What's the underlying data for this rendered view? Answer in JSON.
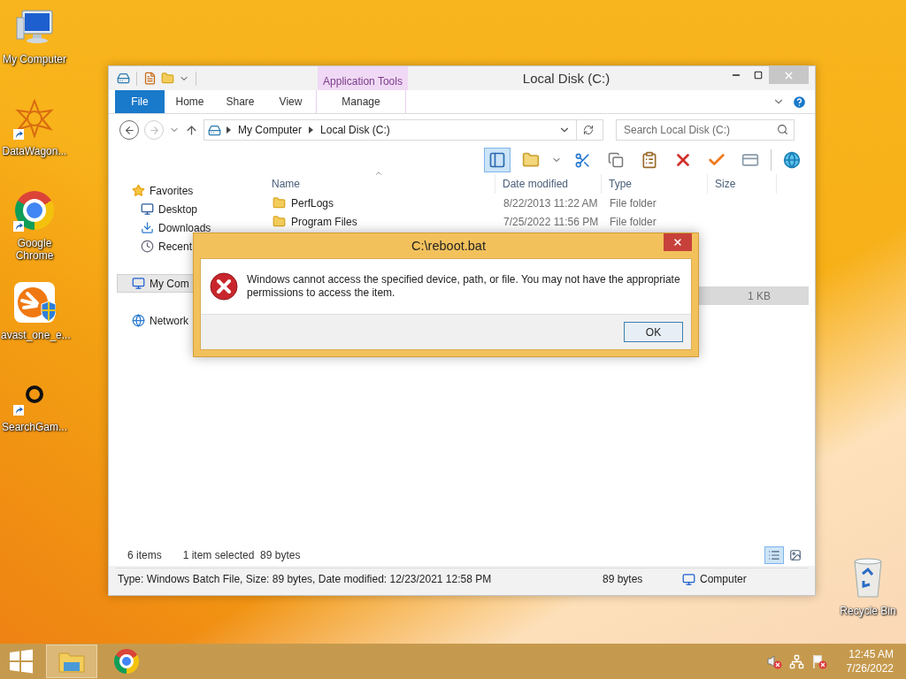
{
  "desktop_icons": [
    {
      "label": "My Computer",
      "kind": "computer",
      "shortcut": false
    },
    {
      "label": "DataWagon...",
      "kind": "datawagon",
      "shortcut": true
    },
    {
      "label": "Google Chrome",
      "kind": "chrome",
      "shortcut": true
    },
    {
      "label": "avast_one_e...",
      "kind": "avast",
      "shortcut": false
    },
    {
      "label": "SearchGam...",
      "kind": "ring",
      "shortcut": true
    }
  ],
  "recycle_bin": {
    "label": "Recycle Bin"
  },
  "explorer": {
    "title": "Local Disk (C:)",
    "context_group": "Application Tools",
    "ribbon_tabs": [
      {
        "label": "File",
        "kind": "file"
      },
      {
        "label": "Home",
        "kind": "normal"
      },
      {
        "label": "Share",
        "kind": "normal"
      },
      {
        "label": "View",
        "kind": "normal"
      },
      {
        "label": "Manage",
        "kind": "contextual"
      }
    ],
    "breadcrumb": [
      "My Computer",
      "Local Disk (C:)"
    ],
    "search": {
      "placeholder": "Search Local Disk (C:)"
    },
    "nav_items": [
      {
        "label": "Favorites",
        "kind": "favorites",
        "selected": false,
        "children": [
          {
            "label": "Desktop",
            "kind": "desktop",
            "selected": false
          },
          {
            "label": "Downloads",
            "kind": "downloads",
            "selected": false
          },
          {
            "label": "Recent",
            "kind": "recent",
            "selected": false
          }
        ]
      },
      {
        "label": "My Com",
        "kind": "computer",
        "selected": true
      },
      {
        "label": "Network",
        "kind": "network",
        "selected": false
      }
    ],
    "columns": [
      "Name",
      "Date modified",
      "Type",
      "Size"
    ],
    "rows": [
      {
        "name": "PerfLogs",
        "date": "8/22/2013 11:22 AM",
        "type": "File folder",
        "selected": false
      },
      {
        "name": "Program Files",
        "date": "7/25/2022 11:56 PM",
        "type": "File folder",
        "selected": false
      },
      {
        "selected": false
      },
      {
        "selected": false
      },
      {
        "selected": false
      },
      {
        "size": "1 KB",
        "selected": true
      }
    ],
    "status": {
      "count": "6 items",
      "selection": "1 item selected  89 bytes"
    },
    "details_bar": {
      "info": "Type: Windows Batch File, Size: 89 bytes, Date modified: 12/23/2021 12:58 PM",
      "size": "89 bytes",
      "location": "Computer"
    }
  },
  "dialog": {
    "title": "C:\\reboot.bat",
    "message": "Windows cannot access the specified device, path, or file. You may not have the appropriate permissions to access the item.",
    "button": "OK"
  },
  "taskbar": {
    "apps": [
      {
        "kind": "explorer",
        "selected": true
      },
      {
        "kind": "chrome",
        "selected": false
      }
    ],
    "time": "12:45 AM",
    "date": "7/26/2022"
  }
}
